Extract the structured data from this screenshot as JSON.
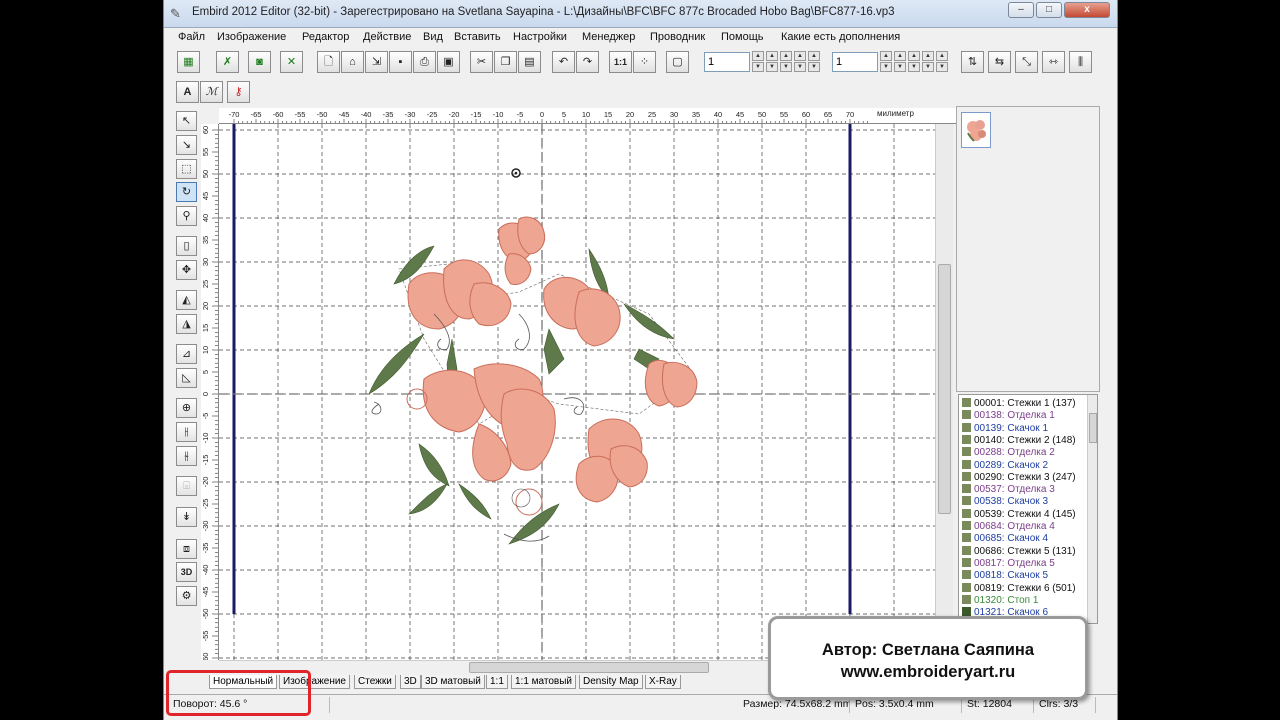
{
  "window": {
    "title": "Embird 2012 Editor (32-bit) - Зарегестрировано на Svetlana Sayapina - L:\\Дизайны\\BFC\\BFC 877c  Brocaded Hobo Bag\\BFC877-16.vp3",
    "minimize": "–",
    "maximize": "□",
    "close": "x"
  },
  "menu": [
    "Файл",
    "Изображение",
    "Редактор",
    "Действие",
    "Вид",
    "Вставить",
    "Настройки",
    "Менеджер",
    "Проводник",
    "Помощь",
    "Какие есть дополнения"
  ],
  "toolbar": {
    "spin1_value": "1",
    "spin2_value": "1",
    "btn_11": "1:1",
    "btn_text_a": "A"
  },
  "ruler": {
    "unit": "милиметр",
    "h_ticks": [
      "-70",
      "-65",
      "-60",
      "-55",
      "-50",
      "-45",
      "-40",
      "-35",
      "-30",
      "-25",
      "-20",
      "-15",
      "-10",
      "-5",
      "0",
      "5",
      "10",
      "15",
      "20",
      "25",
      "30",
      "35",
      "40",
      "45",
      "50",
      "55",
      "60",
      "65",
      "70"
    ],
    "v_ticks": [
      "60",
      "55",
      "50",
      "45",
      "40",
      "35",
      "30",
      "25",
      "20",
      "15",
      "10",
      "5",
      "0",
      "-5",
      "-10",
      "-15",
      "-20",
      "-25",
      "-30",
      "-35",
      "-40",
      "-45",
      "-50",
      "-55",
      "-60"
    ]
  },
  "tabs": [
    "Нормальный",
    "Изображение",
    "Стежки",
    "3D",
    "3D матовый",
    "1:1",
    "1:1 матовый",
    "Density Map",
    "X-Ray"
  ],
  "status": {
    "rotation": "Поворот: 45.6 °",
    "size": "Размер: 74.5x68.2 mm",
    "pos": "Pos: 3.5x0.4 mm",
    "stitches": "St: 12804",
    "colors": "Clrs: 3/3"
  },
  "palette": {
    "colors": [
      "#8a8f6f",
      "#6d7a53",
      "#c97d6a",
      "#e8a090",
      "#d98a78"
    ]
  },
  "stitch_list": [
    {
      "code": "00001:",
      "label": "Стежки 1 (137)",
      "kind": "stitch",
      "swatch": "#7a8a5a"
    },
    {
      "code": "00138:",
      "label": "Отделка 1",
      "kind": "trim",
      "swatch": "#7a8a5a"
    },
    {
      "code": "00139:",
      "label": "Скачок 1",
      "kind": "jump",
      "swatch": "#7a8a5a"
    },
    {
      "code": "00140:",
      "label": "Стежки 2 (148)",
      "kind": "stitch",
      "swatch": "#7a8a5a"
    },
    {
      "code": "00288:",
      "label": "Отделка 2",
      "kind": "trim",
      "swatch": "#7a8a5a"
    },
    {
      "code": "00289:",
      "label": "Скачок 2",
      "kind": "jump",
      "swatch": "#7a8a5a"
    },
    {
      "code": "00290:",
      "label": "Стежки 3 (247)",
      "kind": "stitch",
      "swatch": "#7a8a5a"
    },
    {
      "code": "00537:",
      "label": "Отделка 3",
      "kind": "trim",
      "swatch": "#7a8a5a"
    },
    {
      "code": "00538:",
      "label": "Скачок 3",
      "kind": "jump",
      "swatch": "#7a8a5a"
    },
    {
      "code": "00539:",
      "label": "Стежки 4 (145)",
      "kind": "stitch",
      "swatch": "#7a8a5a"
    },
    {
      "code": "00684:",
      "label": "Отделка 4",
      "kind": "trim",
      "swatch": "#7a8a5a"
    },
    {
      "code": "00685:",
      "label": "Скачок 4",
      "kind": "jump",
      "swatch": "#7a8a5a"
    },
    {
      "code": "00686:",
      "label": "Стежки 5 (131)",
      "kind": "stitch",
      "swatch": "#7a8a5a"
    },
    {
      "code": "00817:",
      "label": "Отделка 5",
      "kind": "trim",
      "swatch": "#7a8a5a"
    },
    {
      "code": "00818:",
      "label": "Скачок 5",
      "kind": "jump",
      "swatch": "#7a8a5a"
    },
    {
      "code": "00819:",
      "label": "Стежки 6 (501)",
      "kind": "stitch",
      "swatch": "#7a8a5a"
    },
    {
      "code": "01320:",
      "label": "Стоп 1",
      "kind": "stop",
      "swatch": "#7a8a5a"
    },
    {
      "code": "01321:",
      "label": "Скачок 6",
      "kind": "jump",
      "swatch": "#3d5a2a"
    }
  ],
  "overlay": {
    "author": "Автор: Светлана Саяпина",
    "site": "www.embroideryart.ru"
  },
  "colors": {
    "trim": "#7a3d8a",
    "jump": "#2040a0",
    "stop": "#3a8a3a",
    "stitch": "#111111",
    "highlight": "#e0252a"
  }
}
